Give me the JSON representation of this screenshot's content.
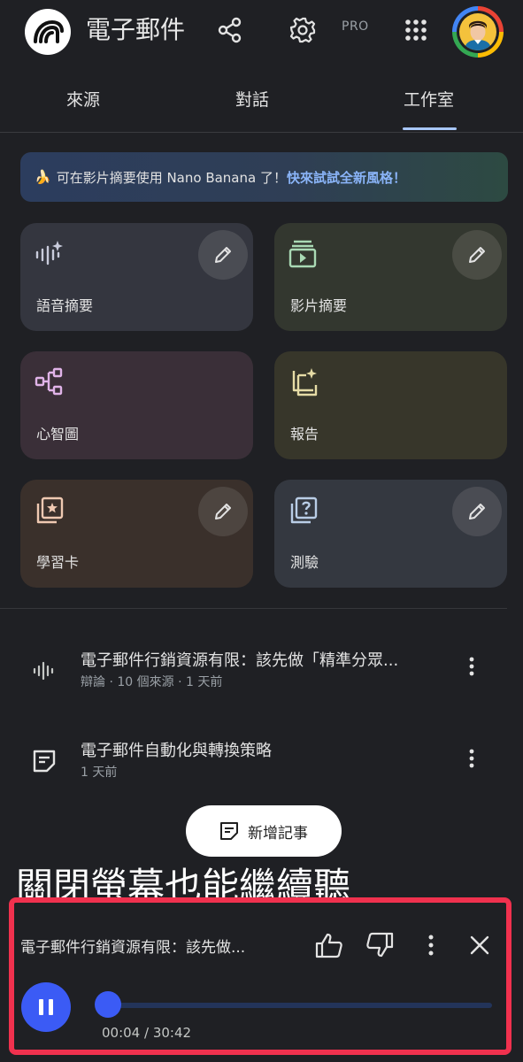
{
  "header": {
    "title": "電子郵件",
    "pro_label": "PRO",
    "icons": [
      "notebooklm-logo-icon",
      "share-icon",
      "settings-icon",
      "apps-grid-icon",
      "avatar"
    ]
  },
  "tabs": [
    {
      "label": "來源",
      "selected": false
    },
    {
      "label": "對話",
      "selected": false
    },
    {
      "label": "工作室",
      "selected": true
    }
  ],
  "banner": {
    "emoji": "🍌",
    "text": "可在影片摘要使用 Nano Banana 了！",
    "link": "快來試試全新風格！"
  },
  "cards": [
    {
      "label": "語音摘要",
      "icon": "audio-spark-icon",
      "editable": true
    },
    {
      "label": "影片摘要",
      "icon": "video-summary-icon",
      "editable": true
    },
    {
      "label": "心智圖",
      "icon": "mind-map-icon",
      "editable": false
    },
    {
      "label": "報告",
      "icon": "report-spark-icon",
      "editable": false
    },
    {
      "label": "學習卡",
      "icon": "flashcards-icon",
      "editable": true
    },
    {
      "label": "測驗",
      "icon": "quiz-icon",
      "editable": true
    }
  ],
  "notes": [
    {
      "title": "電子郵件行銷資源有限：該先做「精準分眾...",
      "subtitle": "辯論 · 10 個來源 · 1 天前",
      "icon": "audio-wave-icon"
    },
    {
      "title": "電子郵件自動化與轉換策略",
      "subtitle": "1 天前",
      "icon": "note-icon"
    }
  ],
  "new_note_label": "新增記事",
  "overlay_caption": "關閉螢幕也能繼續聽",
  "player": {
    "title": "電子郵件行銷資源有限：該先做...",
    "current_time": "00:04",
    "total_time": "30:42",
    "time_display": "00:04 / 30:42",
    "progress": 0.0022
  },
  "colors": {
    "background": "#1f2024",
    "accent": "#3b5bf5",
    "highlight_border": "#f0314e",
    "link": "#8ab4f8"
  }
}
